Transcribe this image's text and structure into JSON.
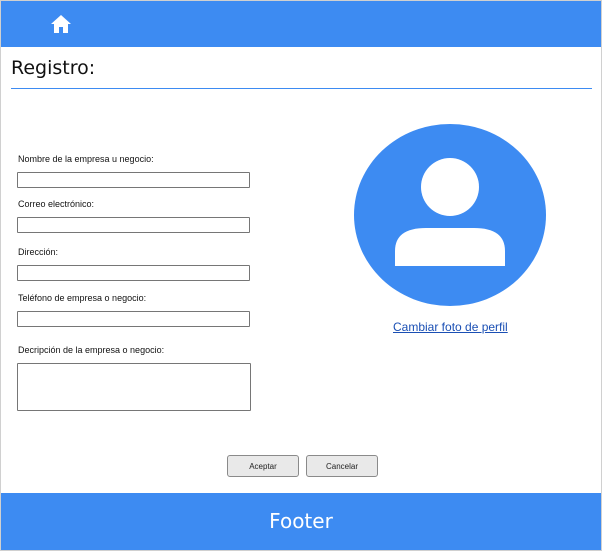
{
  "header": {
    "home_icon": "home-icon"
  },
  "page": {
    "title": "Registro:"
  },
  "form": {
    "fields": [
      {
        "label": "Nombre de la empresa u negocio:",
        "value": ""
      },
      {
        "label": "Correo electrónico:",
        "value": ""
      },
      {
        "label": "Dirección:",
        "value": ""
      },
      {
        "label": "Teléfono de empresa o negocio:",
        "value": ""
      },
      {
        "label": "Decripción de la empresa o negocio:",
        "value": ""
      }
    ]
  },
  "profile": {
    "avatar_icon": "user-avatar-icon",
    "change_photo_label": "Cambiar foto de perfil"
  },
  "actions": {
    "accept_label": "Aceptar",
    "cancel_label": "Cancelar"
  },
  "footer": {
    "text": "Footer"
  },
  "colors": {
    "accent": "#3d8bf2",
    "link": "#1a4fb4"
  }
}
